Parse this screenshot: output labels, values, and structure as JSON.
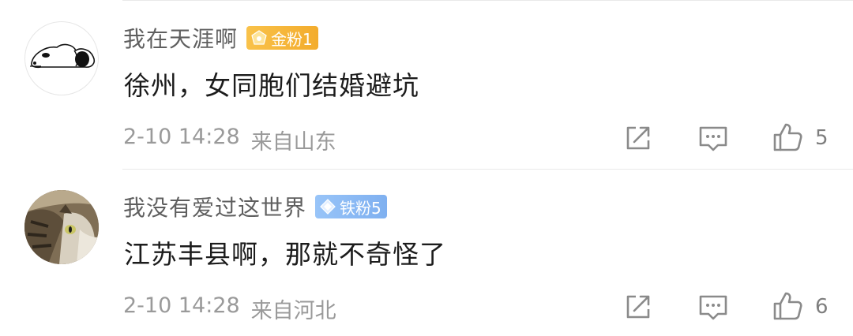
{
  "comments": [
    {
      "username": "我在天涯啊",
      "badge": "金粉1",
      "badge_type": "gold",
      "text": "徐州，女同胞们结婚避坑",
      "time": "2-10 14:28",
      "location": "来自山东",
      "like_count": "5",
      "avatar": "snoopy-avatar"
    },
    {
      "username": "我没有爱过这世界",
      "badge": "铁粉5",
      "badge_type": "iron",
      "text": "江苏丰县啊，那就不奇怪了",
      "time": "2-10 14:28",
      "location": "来自河北",
      "like_count": "6",
      "avatar": "cat-avatar"
    }
  ],
  "icons": {
    "share": "share-icon",
    "reply": "comment-reply-icon",
    "like": "thumbs-up-icon"
  },
  "colors": {
    "gold_badge": "#f5b43a",
    "iron_badge": "#8ab9f4",
    "meta_gray": "#9a9a9a",
    "username_gray": "#5f5f5f",
    "divider": "#e9e9e9"
  }
}
